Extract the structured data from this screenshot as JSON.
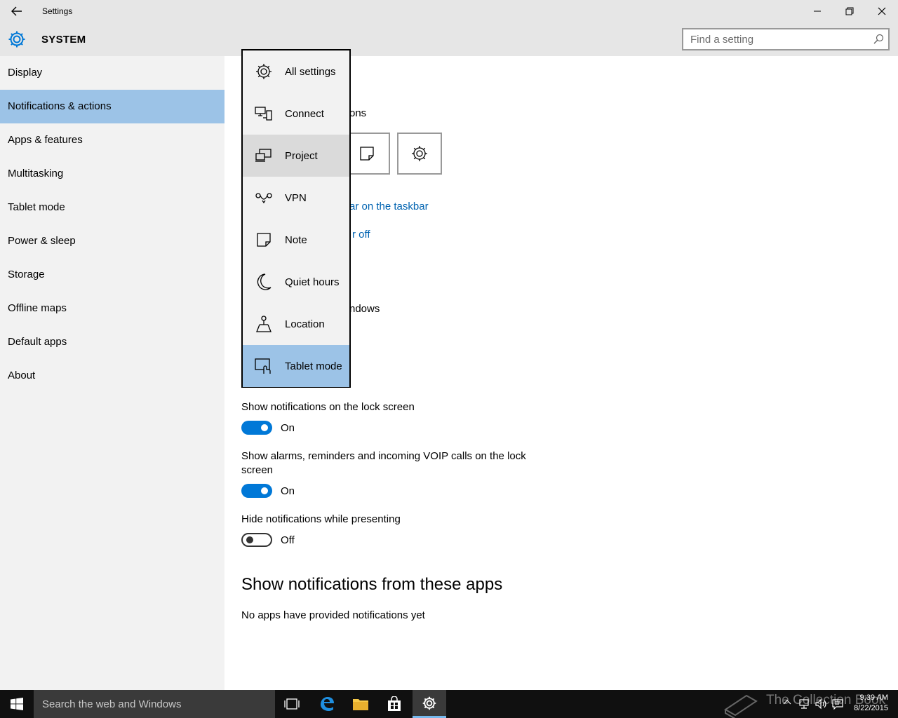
{
  "window": {
    "title": "Settings"
  },
  "header": {
    "section": "SYSTEM",
    "search_placeholder": "Find a setting"
  },
  "sidebar": {
    "items": [
      {
        "label": "Display"
      },
      {
        "label": "Notifications & actions",
        "active": true
      },
      {
        "label": "Apps & features"
      },
      {
        "label": "Multitasking"
      },
      {
        "label": "Tablet mode"
      },
      {
        "label": "Power & sleep"
      },
      {
        "label": "Storage"
      },
      {
        "label": "Offline maps"
      },
      {
        "label": "Default apps"
      },
      {
        "label": "About"
      }
    ]
  },
  "main": {
    "fragments": {
      "quick_actions_tail": "ons",
      "link_taskbar_tail": "ar on the taskbar",
      "link_off_tail": "r off",
      "windows_tail": "ndows"
    },
    "settings": [
      {
        "label": "Show notifications on the lock screen",
        "state": "On"
      },
      {
        "label": "Show alarms, reminders and incoming VOIP calls on the lock",
        "label2": "screen",
        "state": "On"
      },
      {
        "label": "Hide notifications while presenting",
        "state": "Off"
      }
    ],
    "apps_heading": "Show notifications from these apps",
    "apps_empty": "No apps have provided notifications yet"
  },
  "dropdown": {
    "items": [
      {
        "label": "All settings",
        "icon": "gear-icon"
      },
      {
        "label": "Connect",
        "icon": "connect-icon"
      },
      {
        "label": "Project",
        "icon": "project-icon",
        "hover": true
      },
      {
        "label": "VPN",
        "icon": "vpn-icon"
      },
      {
        "label": "Note",
        "icon": "note-icon"
      },
      {
        "label": "Quiet hours",
        "icon": "moon-icon"
      },
      {
        "label": "Location",
        "icon": "location-icon"
      },
      {
        "label": "Tablet mode",
        "icon": "tablet-mode-icon",
        "selected": true
      }
    ]
  },
  "taskbar": {
    "search_placeholder": "Search the web and Windows",
    "time": "9:39 AM",
    "date": "8/22/2015",
    "watermark": "The Collection Book"
  },
  "colors": {
    "accent": "#0078d7",
    "selection": "#9cc3e7",
    "link": "#0063b1"
  }
}
